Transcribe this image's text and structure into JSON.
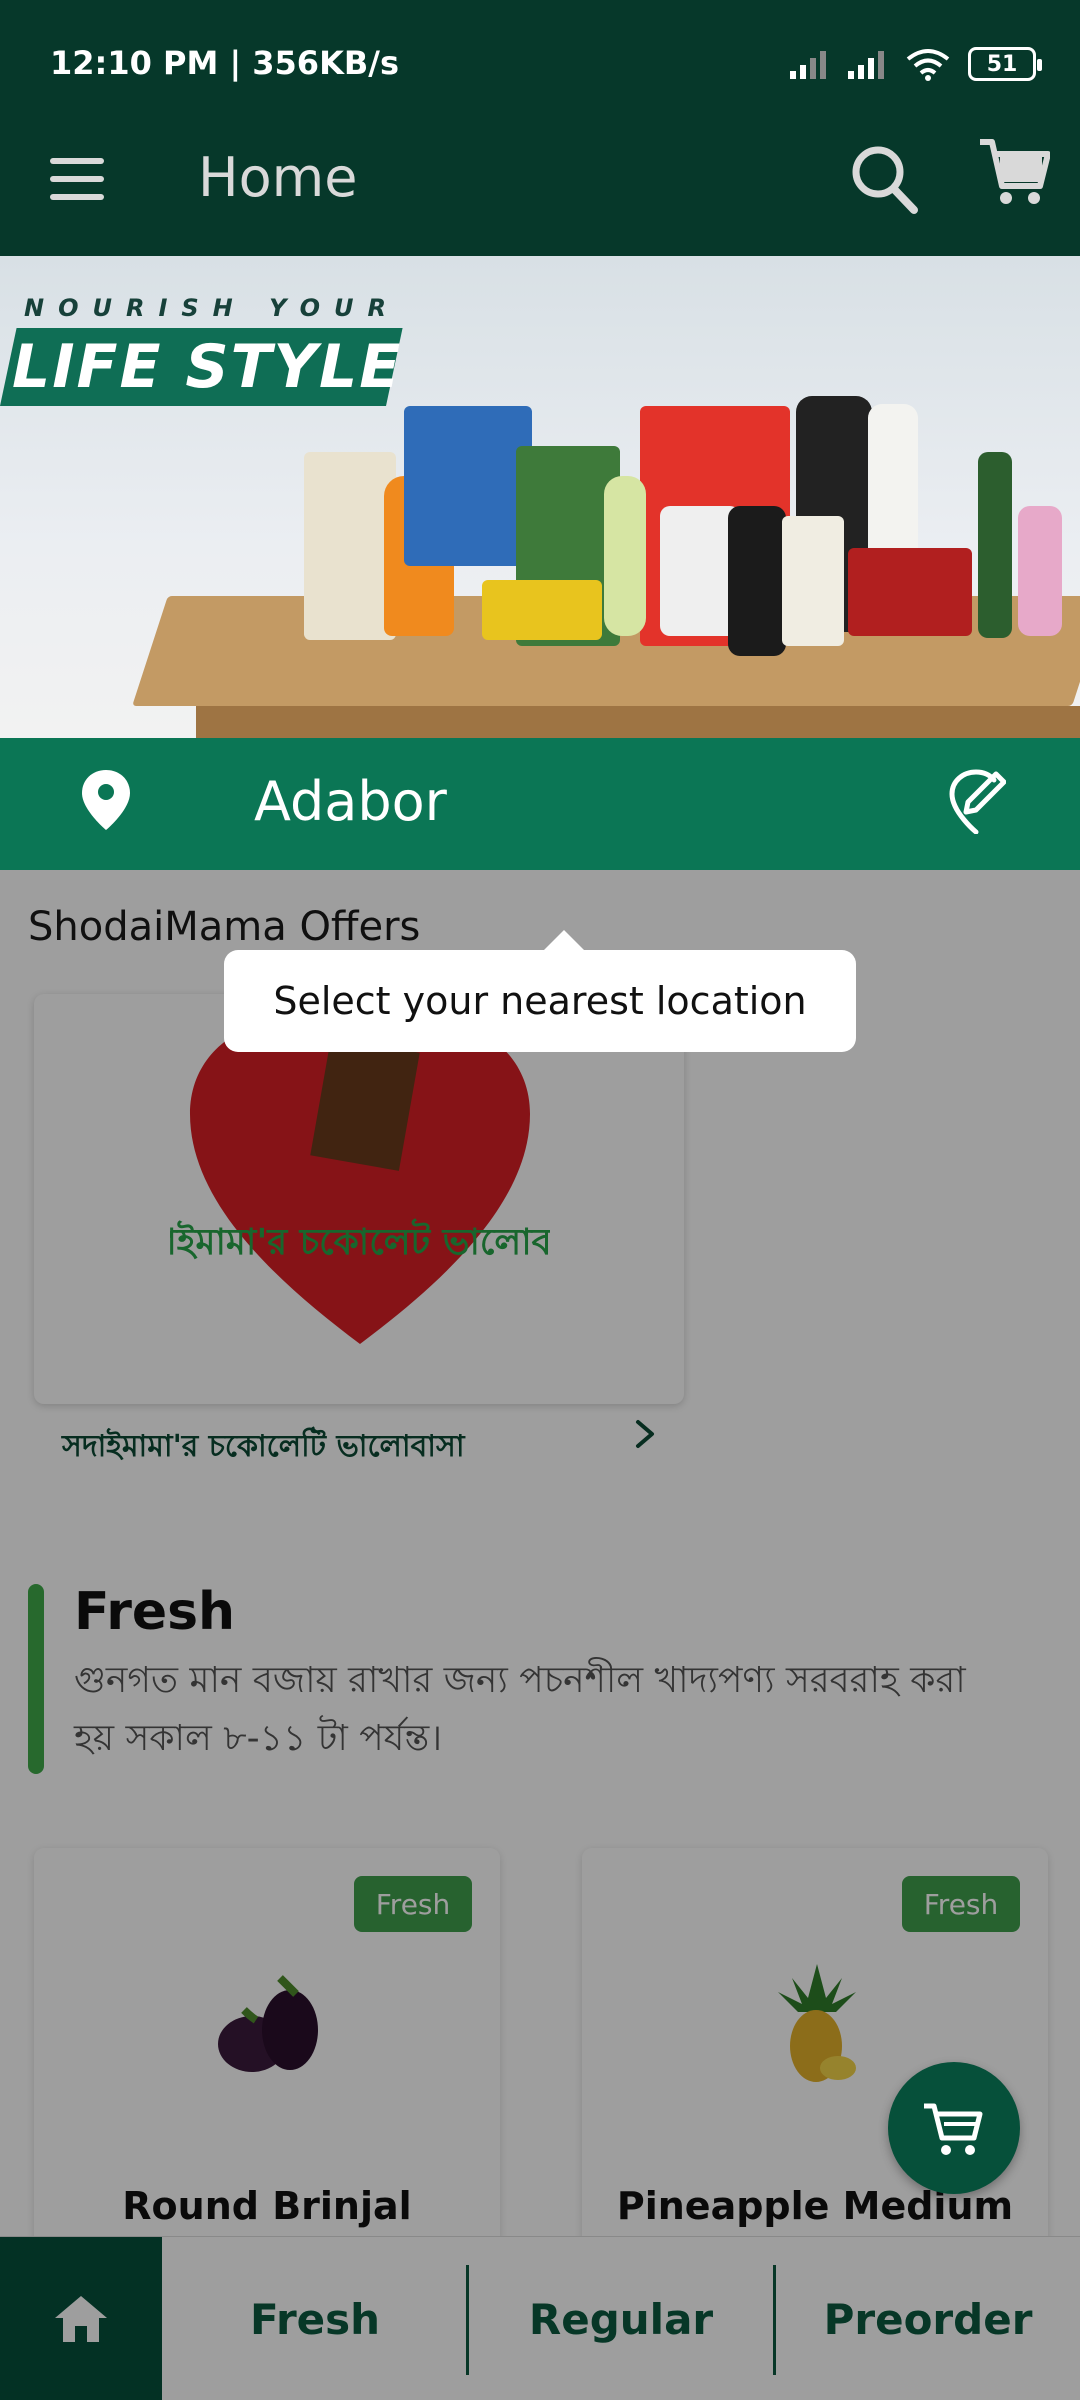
{
  "status_bar": {
    "time": "12:10 PM | 356KB/s",
    "battery": "51"
  },
  "app_bar": {
    "title": "Home",
    "menu_icon": "hamburger-menu-icon",
    "search_icon": "search-icon",
    "cart_icon": "cart-icon"
  },
  "banner": {
    "subtitle": "NOURISH YOUR",
    "title": "LIFE STYLE"
  },
  "location": {
    "name": "Adabor",
    "pin_icon": "location-pin-icon",
    "edit_icon": "edit-location-icon"
  },
  "offers": {
    "title": "ShodaiMama Offers",
    "card_label": "সদাইমামা'র চকোলেটি ভালোবাসা",
    "artwork_text": "সদাইমামা'র চকোলেট ভালোবাসা"
  },
  "fresh": {
    "title": "Fresh",
    "description": "গুনগত মান বজায় রাখার জন্য পচনশীল খাদ্যপণ্য সরবরাহ করা হয় সকাল ৮-১১ টা পর্যন্ত।"
  },
  "products": [
    {
      "badge": "Fresh",
      "name": "Round Brinjal"
    },
    {
      "badge": "Fresh",
      "name": "Pineapple Medium"
    }
  ],
  "tooltip": {
    "text": "Select your nearest location"
  },
  "bottom_nav": {
    "home_icon": "home-icon",
    "tabs": [
      "Fresh",
      "Regular",
      "Preorder"
    ]
  },
  "colors": {
    "app_bar": "#06382a",
    "location_bar": "#0b7655",
    "badge": "#3f9e4c",
    "accent_text": "#0c5a40"
  }
}
